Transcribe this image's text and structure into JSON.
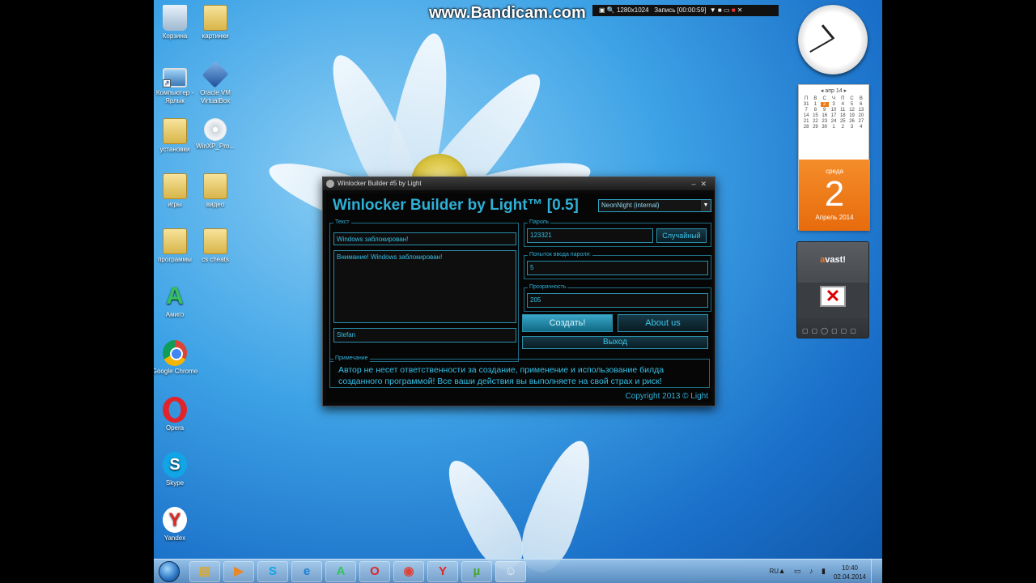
{
  "desktop": {
    "icons": [
      {
        "label": "Корзина"
      },
      {
        "label": "картинки"
      },
      {
        "label": "Компьютер - Ярлык"
      },
      {
        "label": "Oracle VM VirtualBox"
      },
      {
        "label": "установки"
      },
      {
        "label": "WinXP_Pro..."
      },
      {
        "label": "игры"
      },
      {
        "label": "видео"
      },
      {
        "label": "программы"
      },
      {
        "label": "cs cheats"
      },
      {
        "label": "Амиго"
      },
      {
        "label": "Google Chrome"
      },
      {
        "label": "Opera"
      },
      {
        "label": "Skype"
      },
      {
        "label": "Yandex"
      }
    ]
  },
  "bandicam": {
    "watermark": "www.Bandicam.com",
    "resolution": "1280x1024",
    "record_label": "Запись [00:00:59]"
  },
  "calendar": {
    "month_header": "апр 14",
    "weekdays": [
      "П",
      "В",
      "С",
      "Ч",
      "П",
      "С",
      "В"
    ],
    "days": [
      "31",
      "1",
      "2",
      "3",
      "4",
      "5",
      "6",
      "7",
      "8",
      "9",
      "10",
      "11",
      "12",
      "13",
      "14",
      "15",
      "16",
      "17",
      "18",
      "19",
      "20",
      "21",
      "22",
      "23",
      "24",
      "25",
      "26",
      "27",
      "28",
      "29",
      "30",
      "1",
      "2",
      "3",
      "4"
    ],
    "today_index": 2,
    "day_name": "среда",
    "day_number": "2",
    "month_year": "Апрель 2014"
  },
  "clock": {
    "hour": 10,
    "minute": 40
  },
  "avast": {
    "logo_a": "a",
    "logo_rest": "vast!"
  },
  "window": {
    "title": "Winlocker Builder #5 by Light",
    "heading": "Winlocker Builder by Light™ [0.5]",
    "skin_value": "NeonNight (internal)",
    "text_group_label": "Текст",
    "text_title_value": "Windows заблокирован!",
    "text_body_value": "Внимание! Windows заблокирован!",
    "text_author_value": "Stefan",
    "password_group_label": "Пароль",
    "password_value": "123321",
    "random_button": "Случайный",
    "attempts_group_label": "Попыток ввода пароля:",
    "attempts_value": "5",
    "opacity_group_label": "Прозрачность",
    "opacity_value": "205",
    "create_button": "Создать!",
    "about_button": "About us",
    "exit_button": "Выход",
    "note_group_label": "Примечание",
    "note_text": "Автор не несет ответственности за создание, применение и использование билда созданного программой! Все ваши действия вы выполняете на свой страх и риск!",
    "copyright": "Copyright 2013 © Light"
  },
  "taskbar": {
    "lang": "RU",
    "time": "10:40",
    "date": "02.04.2014",
    "tray_glyphs": "▲ ▭ ♪ ▮"
  }
}
